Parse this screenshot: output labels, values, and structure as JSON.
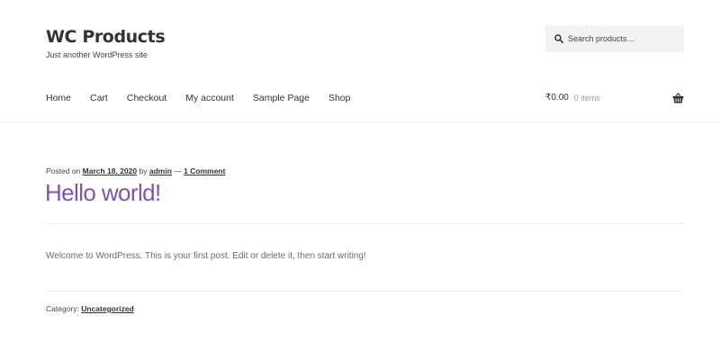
{
  "site": {
    "title": "WC Products",
    "tagline": "Just another WordPress site"
  },
  "search": {
    "placeholder": "Search products…",
    "icon": "search-icon"
  },
  "nav": {
    "items": [
      {
        "label": "Home"
      },
      {
        "label": "Cart"
      },
      {
        "label": "Checkout"
      },
      {
        "label": "My account"
      },
      {
        "label": "Sample Page"
      },
      {
        "label": "Shop"
      }
    ]
  },
  "cart": {
    "amount": "₹0.00",
    "count": "0 items",
    "icon": "basket-icon"
  },
  "post": {
    "posted_on_label": "Posted on",
    "date": "March 18, 2020",
    "by_label": "by",
    "author": "admin",
    "separator": "—",
    "comments": "1 Comment",
    "title": "Hello world!",
    "body": "Welcome to WordPress. This is your first post. Edit or delete it, then start writing!",
    "category_label": "Category:",
    "category": "Uncategorized"
  },
  "colors": {
    "accent": "#7f54b3",
    "text": "#43454b",
    "heading": "#333333",
    "search_bg": "#f2f2f2",
    "divider": "#ececec"
  }
}
